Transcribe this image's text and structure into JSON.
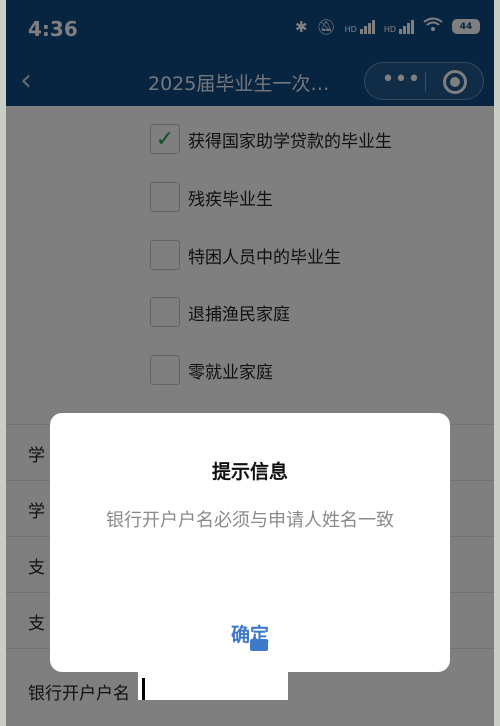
{
  "status_bar": {
    "time": "4:36",
    "network_1": "HD",
    "network_2": "HD",
    "battery": "44"
  },
  "nav": {
    "back_symbol": "‹",
    "title": "2025届毕业生一次…",
    "more_symbol": "•••"
  },
  "options": [
    {
      "label": "获得国家助学贷款的毕业生",
      "checked": true
    },
    {
      "label": "残疾毕业生",
      "checked": false
    },
    {
      "label": "特困人员中的毕业生",
      "checked": false
    },
    {
      "label": "退捕渔民家庭",
      "checked": false
    },
    {
      "label": "零就业家庭",
      "checked": false
    }
  ],
  "form_rows": [
    {
      "label": "学"
    },
    {
      "label": "学"
    },
    {
      "label": "支"
    },
    {
      "label": "支"
    },
    {
      "label": "银行开户户名"
    }
  ],
  "dialog": {
    "title": "提示信息",
    "message": "银行开户户名必须与申请人姓名一致",
    "confirm_label": "确定"
  },
  "colors": {
    "nav_bg": "#0f4a83",
    "accent": "#3f79c9",
    "check": "#1ea34a"
  },
  "icons": [
    "back-icon",
    "more-icon",
    "close-icon",
    "bluetooth-icon",
    "mute-icon",
    "wifi-icon",
    "battery-icon",
    "check-icon"
  ]
}
